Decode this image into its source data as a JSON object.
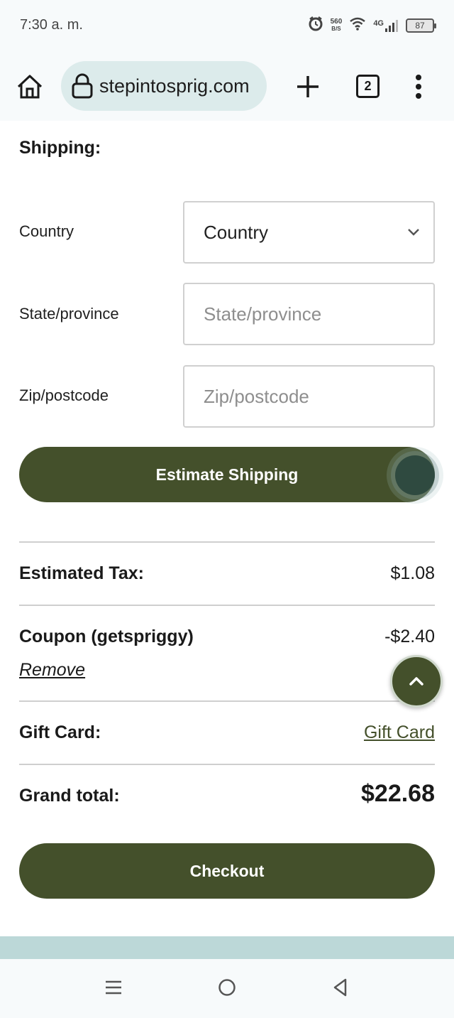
{
  "status_bar": {
    "time": "7:30 a. m.",
    "net_speed_top": "560",
    "net_speed_bottom": "B/S",
    "signal": "4G",
    "battery": "87"
  },
  "browser": {
    "url": "stepintosprig.com",
    "tab_count": "2"
  },
  "shipping": {
    "title": "Shipping:",
    "country_label": "Country",
    "country_value": "Country",
    "state_label": "State/province",
    "state_placeholder": "State/province",
    "zip_label": "Zip/postcode",
    "zip_placeholder": "Zip/postcode",
    "estimate_button": "Estimate Shipping"
  },
  "totals": {
    "tax_label": "Estimated Tax:",
    "tax_value": "$1.08",
    "coupon_label": "Coupon (getspriggy)",
    "coupon_value": "-$2.40",
    "remove_link": "Remove",
    "gift_label": "Gift Card:",
    "gift_link": "Gift Card",
    "grand_label": "Grand total:",
    "grand_value": "$22.68"
  },
  "checkout_button": "Checkout",
  "colors": {
    "brand_green": "#44502b",
    "url_pill": "#dcebeb",
    "footer_band": "#bcd8d8"
  },
  "icons": [
    "alarm-icon",
    "wifi-icon",
    "signal-icon",
    "battery-icon",
    "home-icon",
    "lock-icon",
    "plus-icon",
    "tabs-icon",
    "more-vert-icon",
    "chevron-down-icon",
    "chevron-up-icon",
    "menu-icon",
    "circle-home-icon",
    "back-triangle-icon"
  ]
}
